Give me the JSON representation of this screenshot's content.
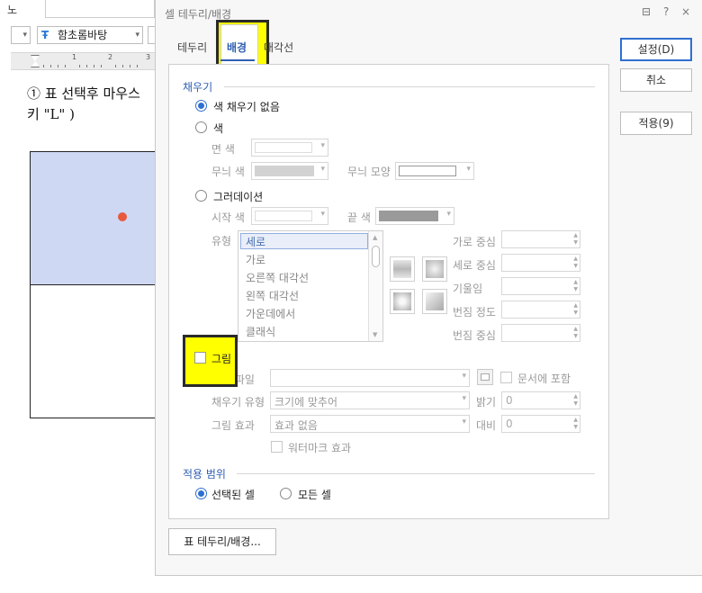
{
  "toolbar": {
    "fragment_label": "노",
    "font_name": "함초롬바탕"
  },
  "ruler": {
    "numbers": [
      "1",
      "2",
      "3"
    ]
  },
  "document": {
    "line1": "① 표 선택후 마우스",
    "line2": "키 \"L\" )"
  },
  "dialog": {
    "title": "셀 테두리/배경",
    "title_icons": [
      "⊟",
      "?",
      "×"
    ],
    "tabs": [
      {
        "label": "테두리"
      },
      {
        "label": "배경"
      },
      {
        "label": "대각선"
      }
    ],
    "buttons": {
      "ok": "설정(D)",
      "cancel": "취소",
      "apply": "적용(9)"
    },
    "fill": {
      "section_title": "채우기",
      "no_fill_label": "색 채우기 없음",
      "color_label": "색",
      "face_color_label": "면 색",
      "pattern_color_label": "무늬 색",
      "pattern_shape_label": "무늬 모양",
      "gradation_label": "그러데이션",
      "start_color_label": "시작 색",
      "end_color_label": "끝 색",
      "type_label": "유형",
      "type_options": [
        "세로",
        "가로",
        "오른쪽 대각선",
        "왼쪽 대각선",
        "가운데에서",
        "클래식"
      ],
      "horizontal_center_label": "가로 중심",
      "vertical_center_label": "세로 중심",
      "slope_label": "기울임",
      "blur_degree_label": "번짐 정도",
      "blur_center_label": "번짐 중심",
      "picture_label": "그림",
      "picture_file_label": "그림 파일",
      "include_in_doc_label": "문서에 포함",
      "fill_type_label": "채우기 유형",
      "fill_type_value": "크기에 맞추어",
      "brightness_label": "밝기",
      "brightness_value": "0",
      "picture_effect_label": "그림 효과",
      "picture_effect_value": "효과 없음",
      "contrast_label": "대비",
      "contrast_value": "0",
      "watermark_label": "워터마크 효과"
    },
    "scope": {
      "section_title": "적용 범위",
      "selected_cell_label": "선택된 셀",
      "all_cells_label": "모든 셀"
    },
    "table_border_button": "표 테두리/배경..."
  },
  "colors": {
    "accent": "#2f6fd0",
    "highlight": "#ffff00",
    "doc_cell": "#cfd8f3",
    "dot": "#e8593e"
  }
}
